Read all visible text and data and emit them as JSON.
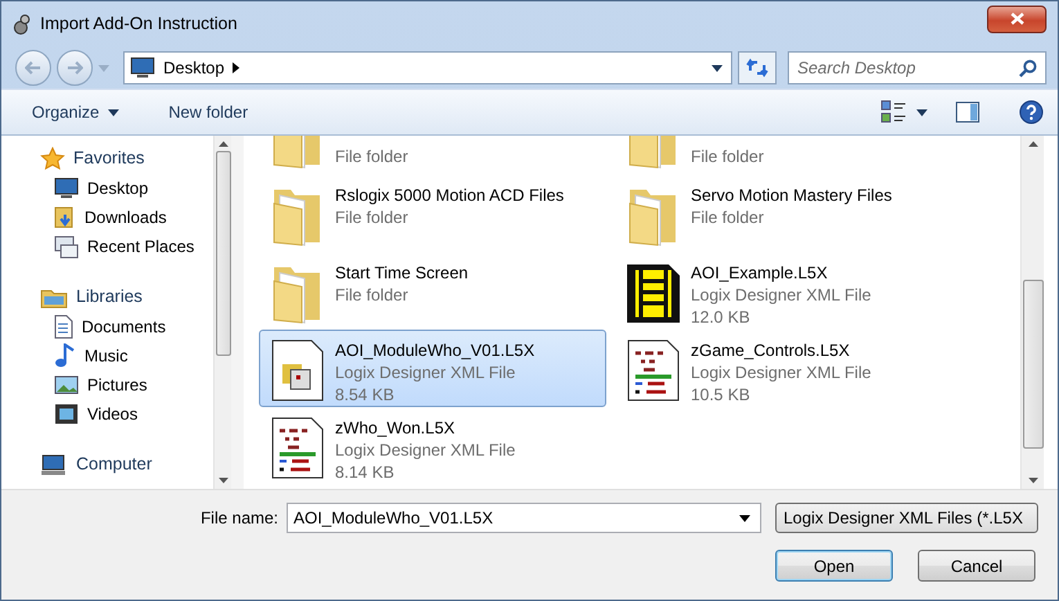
{
  "window": {
    "title": "Import Add-On Instruction"
  },
  "address": {
    "location": "Desktop"
  },
  "search": {
    "placeholder": "Search Desktop"
  },
  "toolbar": {
    "organize": "Organize",
    "new_folder": "New folder"
  },
  "sidebar": {
    "groups": [
      {
        "label": "Favorites",
        "children": [
          {
            "label": "Desktop"
          },
          {
            "label": "Downloads"
          },
          {
            "label": "Recent Places"
          }
        ]
      },
      {
        "label": "Libraries",
        "children": [
          {
            "label": "Documents"
          },
          {
            "label": "Music"
          },
          {
            "label": "Pictures"
          },
          {
            "label": "Videos"
          }
        ]
      },
      {
        "label": "Computer"
      }
    ]
  },
  "files": [
    {
      "type": "File folder",
      "kind": "folder",
      "selected": false
    },
    {
      "type": "File folder",
      "kind": "folder",
      "selected": false
    },
    {
      "name": "Rslogix 5000 Motion ACD Files",
      "type": "File folder",
      "kind": "folder",
      "selected": false
    },
    {
      "name": "Servo Motion Mastery Files",
      "type": "File folder",
      "kind": "folder",
      "selected": false
    },
    {
      "name": "Start Time Screen",
      "type": "File folder",
      "kind": "folder",
      "selected": false
    },
    {
      "name": "AOI_Example.L5X",
      "type": "Logix Designer XML File",
      "size": "12.0 KB",
      "kind": "ladder",
      "selected": false
    },
    {
      "name": "AOI_ModuleWho_V01.L5X",
      "type": "Logix Designer XML File",
      "size": "8.54 KB",
      "kind": "module",
      "selected": true
    },
    {
      "name": "zGame_Controls.L5X",
      "type": "Logix Designer XML File",
      "size": "10.5 KB",
      "kind": "rungs",
      "selected": false
    },
    {
      "name": "zWho_Won.L5X",
      "type": "Logix Designer XML File",
      "size": "8.14 KB",
      "kind": "rungs",
      "selected": false
    }
  ],
  "file_name": {
    "label": "File name:",
    "value": "AOI_ModuleWho_V01.L5X"
  },
  "file_type": {
    "value": "Logix Designer XML Files (*.L5X"
  },
  "buttons": [
    {
      "label": "Open",
      "default": true
    },
    {
      "label": "Cancel",
      "default": false
    }
  ]
}
